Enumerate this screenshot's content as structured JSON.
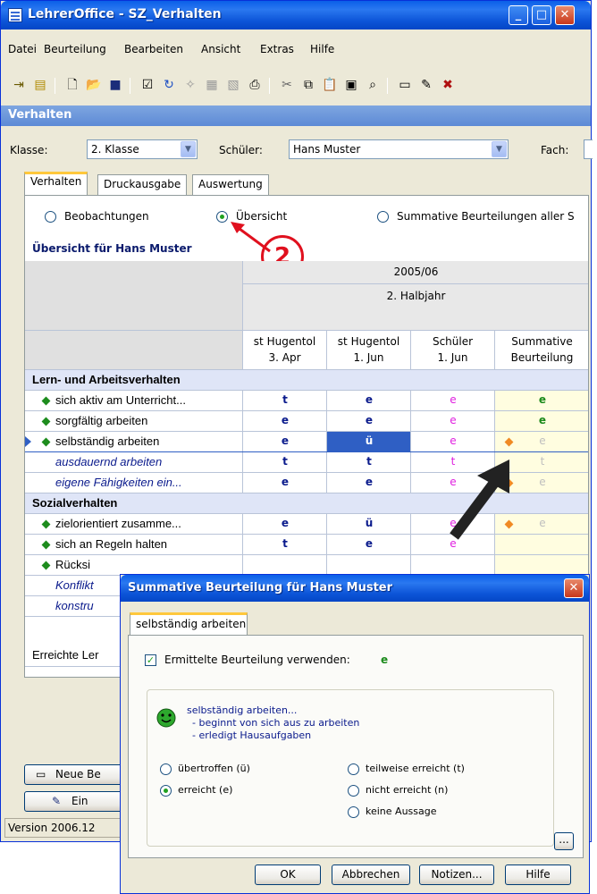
{
  "window": {
    "title": "LehrerOffice - SZ_Verhalten",
    "min": "_",
    "max": "□",
    "close": "✕"
  },
  "menu": [
    "Datei",
    "Beurteilung",
    "Bearbeiten",
    "Ansicht",
    "Extras",
    "Hilfe"
  ],
  "toolbar_icons": [
    "exit-icon",
    "book-icon",
    "new-doc-icon",
    "open-folder-icon",
    "save-icon",
    "properties-icon",
    "sync-icon",
    "wand-icon",
    "import-icon",
    "export-icon",
    "print-icon",
    "cut-icon",
    "copy-icon",
    "paste-icon",
    "clipboard-icon",
    "find-icon",
    "new-item-icon",
    "edit-item-icon",
    "delete-item-icon"
  ],
  "panel_title": "Verhalten",
  "filters": {
    "klasse_label": "Klasse:",
    "klasse_value": "2. Klasse",
    "schueler_label": "Schüler:",
    "schueler_value": "Hans Muster",
    "fach_label": "Fach:"
  },
  "tabs": [
    "Verhalten",
    "Druckausgabe",
    "Auswertung"
  ],
  "view_options": {
    "beobachtungen": "Beobachtungen",
    "uebersicht": "Übersicht",
    "summative": "Summative Beurteilungen aller S"
  },
  "overview_title": "Übersicht für Hans Muster",
  "callout_number": "2",
  "grid": {
    "year": "2005/06",
    "half": "2. Halbjahr",
    "columns": [
      {
        "line1": "st Hugentol",
        "line2": "3. Apr"
      },
      {
        "line1": "st Hugentol",
        "line2": "1. Jun"
      },
      {
        "line1": "Schüler",
        "line2": "1. Jun"
      },
      {
        "line1": "Summative",
        "line2": "Beurteilung"
      }
    ],
    "section1": "Lern- und Arbeitsverhalten",
    "rows1": [
      {
        "label": "sich aktiv am Unterricht...",
        "marks": [
          "t",
          "e",
          "e",
          "e"
        ]
      },
      {
        "label": "sorgfältig arbeiten",
        "marks": [
          "e",
          "e",
          "e",
          "e"
        ]
      },
      {
        "label": "selbständig arbeiten",
        "marks": [
          "e",
          "ü",
          "e",
          "e"
        ]
      },
      {
        "label": "ausdauernd arbeiten",
        "marks": [
          "t",
          "t",
          "t",
          "t"
        ]
      },
      {
        "label": "eigene Fähigkeiten ein...",
        "marks": [
          "e",
          "e",
          "e",
          "e"
        ]
      }
    ],
    "section2": "Sozialverhalten",
    "rows2": [
      {
        "label": "zielorientiert zusamme...",
        "marks": [
          "e",
          "ü",
          "e",
          "e"
        ]
      },
      {
        "label": "sich an Regeln halten",
        "marks": [
          "t",
          "e",
          "e",
          ""
        ]
      },
      {
        "label": "Rücksi",
        "marks": [
          "",
          "",
          "",
          ""
        ]
      },
      {
        "label": "Konflikt",
        "marks": [
          "",
          "",
          "",
          ""
        ]
      },
      {
        "label": "konstru",
        "marks": [
          "",
          "",
          "",
          ""
        ]
      }
    ],
    "footer_label": "Erreichte Ler"
  },
  "buttons": {
    "neue": "Neue Be",
    "ein": "Ein"
  },
  "status": "Version 2006.12",
  "dialog": {
    "title": "Summative Beurteilung für Hans Muster",
    "tab": "selbständig arbeiten",
    "checkbox_label": "Ermittelte Beurteilung verwenden:",
    "checkbox_value": "e",
    "desc_title": "selbständig arbeiten...",
    "desc_line1": "- beginnt von sich aus zu arbeiten",
    "desc_line2": "- erledigt Hausaufgaben",
    "options": {
      "uebertroffen": "übertroffen (ü)",
      "erreicht": "erreicht (e)",
      "teilweise": "teilweise erreicht (t)",
      "nicht": "nicht erreicht (n)",
      "keine": "keine Aussage"
    },
    "selected": "erreicht",
    "ellipsis": "...",
    "btn_ok": "OK",
    "btn_cancel": "Abbrechen",
    "btn_notes": "Notizen...",
    "btn_help": "Hilfe"
  },
  "colors": {
    "t": "#0a1a8c",
    "e_teacher": "#0a1a8c",
    "student": "#e020e0",
    "summ": "#1b8a1b",
    "summ_bg": "#fffde0",
    "selected_bg": "#2f5fc4"
  }
}
